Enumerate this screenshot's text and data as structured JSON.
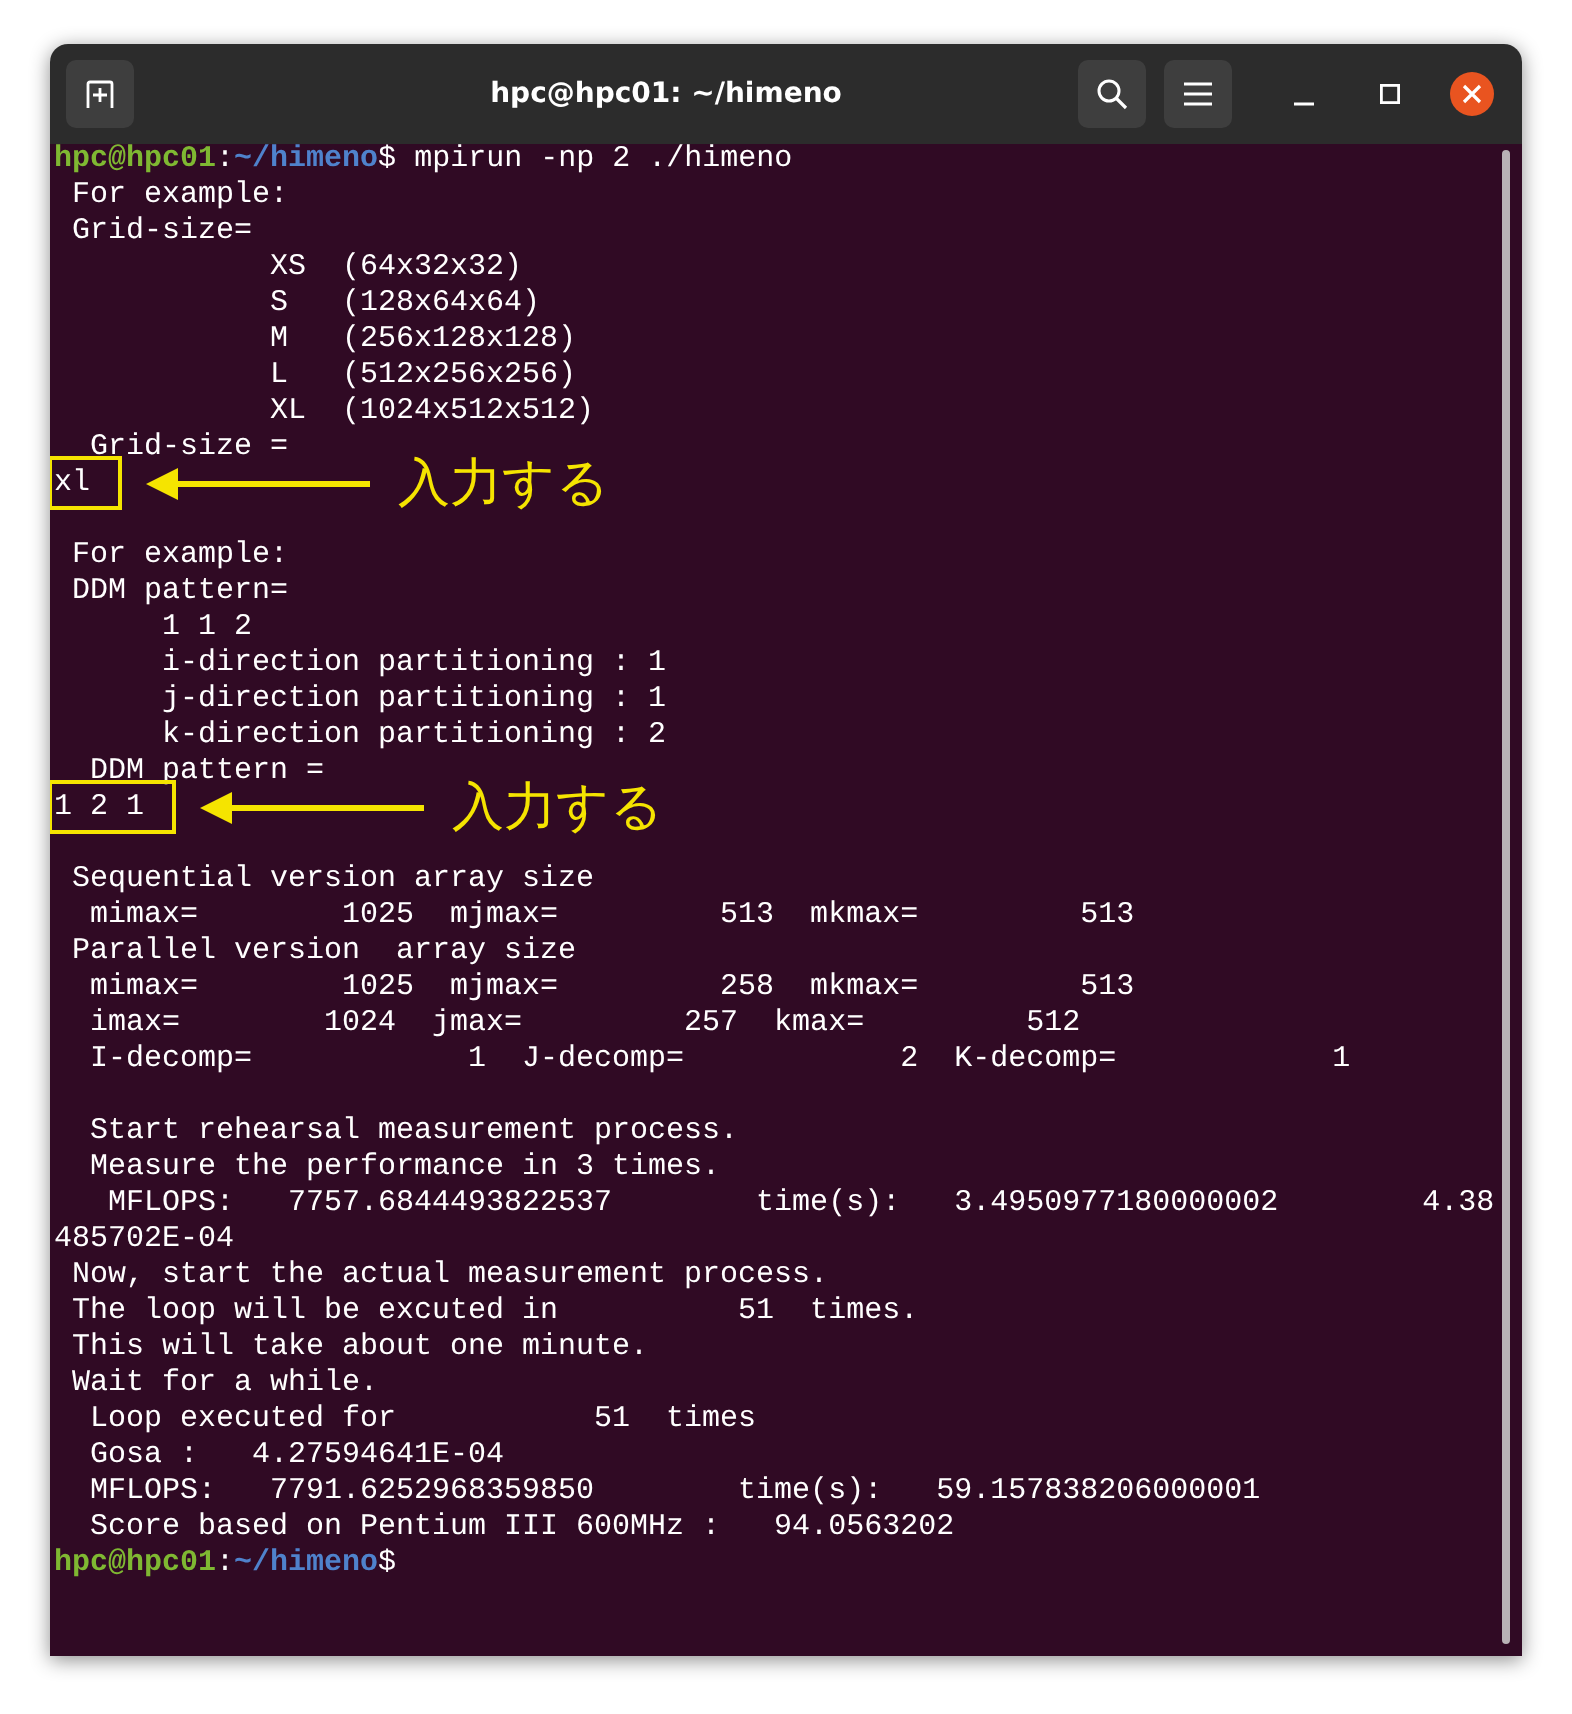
{
  "window": {
    "title": "hpc@hpc01: ~/himeno"
  },
  "terminal": {
    "lines": [
      {
        "kind": "prompt",
        "user_host": "hpc@hpc01",
        "separator": ":",
        "path": "~/himeno",
        "symbol": "$",
        "command": " mpirun -np 2 ./himeno"
      },
      {
        "kind": "output",
        "text": " For example:"
      },
      {
        "kind": "output",
        "text": " Grid-size="
      },
      {
        "kind": "output",
        "text": "            XS  (64x32x32)"
      },
      {
        "kind": "output",
        "text": "            S   (128x64x64)"
      },
      {
        "kind": "output",
        "text": "            M   (256x128x128)"
      },
      {
        "kind": "output",
        "text": "            L   (512x256x256)"
      },
      {
        "kind": "output",
        "text": "            XL  (1024x512x512)"
      },
      {
        "kind": "output",
        "text": "  Grid-size ="
      },
      {
        "kind": "input",
        "text": "xl",
        "note": "入力する"
      },
      {
        "kind": "blank"
      },
      {
        "kind": "output",
        "text": " For example:"
      },
      {
        "kind": "output",
        "text": " DDM pattern="
      },
      {
        "kind": "output",
        "text": "      1 1 2"
      },
      {
        "kind": "output",
        "text": "      i-direction partitioning : 1"
      },
      {
        "kind": "output",
        "text": "      j-direction partitioning : 1"
      },
      {
        "kind": "output",
        "text": "      k-direction partitioning : 2"
      },
      {
        "kind": "output",
        "text": "  DDM pattern ="
      },
      {
        "kind": "input",
        "text": "1 2 1",
        "note": "入力する"
      },
      {
        "kind": "blank"
      },
      {
        "kind": "output",
        "text": " Sequential version array size"
      },
      {
        "kind": "output",
        "text": "  mimax=        1025  mjmax=         513  mkmax=         513"
      },
      {
        "kind": "output",
        "text": " Parallel version  array size"
      },
      {
        "kind": "output",
        "text": "  mimax=        1025  mjmax=         258  mkmax=         513"
      },
      {
        "kind": "output",
        "text": "  imax=        1024  jmax=         257  kmax=         512"
      },
      {
        "kind": "output",
        "text": "  I-decomp=            1  J-decomp=            2  K-decomp=            1"
      },
      {
        "kind": "blank"
      },
      {
        "kind": "output",
        "text": "  Start rehearsal measurement process."
      },
      {
        "kind": "output",
        "text": "  Measure the performance in 3 times."
      },
      {
        "kind": "output",
        "text": "   MFLOPS:   7757.6844493822537        time(s):   3.4950977180000002        4.38"
      },
      {
        "kind": "output",
        "text": "485702E-04"
      },
      {
        "kind": "output",
        "text": " Now, start the actual measurement process."
      },
      {
        "kind": "output",
        "text": " The loop will be excuted in          51  times."
      },
      {
        "kind": "output",
        "text": " This will take about one minute."
      },
      {
        "kind": "output",
        "text": " Wait for a while."
      },
      {
        "kind": "output",
        "text": "  Loop executed for           51  times"
      },
      {
        "kind": "output",
        "text": "  Gosa :   4.27594641E-04"
      },
      {
        "kind": "output",
        "text": "  MFLOPS:   7791.6252968359850        time(s):   59.157838206000001"
      },
      {
        "kind": "output",
        "text": "  Score based on Pentium III 600MHz :   94.0563202"
      },
      {
        "kind": "prompt",
        "user_host": "hpc@hpc01",
        "separator": ":",
        "path": "~/himeno",
        "symbol": "$"
      }
    ]
  }
}
